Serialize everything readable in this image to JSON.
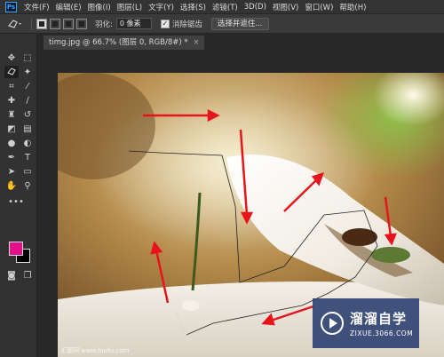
{
  "app": {
    "logo_text": "Ps"
  },
  "menu": [
    "文件(F)",
    "编辑(E)",
    "图像(I)",
    "图层(L)",
    "文字(Y)",
    "选择(S)",
    "滤镜(T)",
    "3D(D)",
    "视图(V)",
    "窗口(W)",
    "帮助(H)"
  ],
  "options_bar": {
    "tool_icon": "lasso-icon",
    "feather_label": "羽化:",
    "feather_value": "0 像素",
    "antialias_label": "消除锯齿",
    "antialias_checked": true,
    "select_mask_label": "选择并遮住..."
  },
  "document": {
    "tab_title": "timg.jpg @ 66.7% (图层 0, RGB/8#) *",
    "close_glyph": "×"
  },
  "toolbox": {
    "foreground_color": "#e60f8a",
    "background_color": "#000000",
    "more_glyph": "•••"
  },
  "watermark": {
    "title": "溜溜自学",
    "url": "ZIXUE.3066.COM",
    "corner_text": "汇图网 www.huitu.com"
  },
  "colors": {
    "arrow_red": "#e8141c",
    "accent_blue": "#31a8ff"
  }
}
